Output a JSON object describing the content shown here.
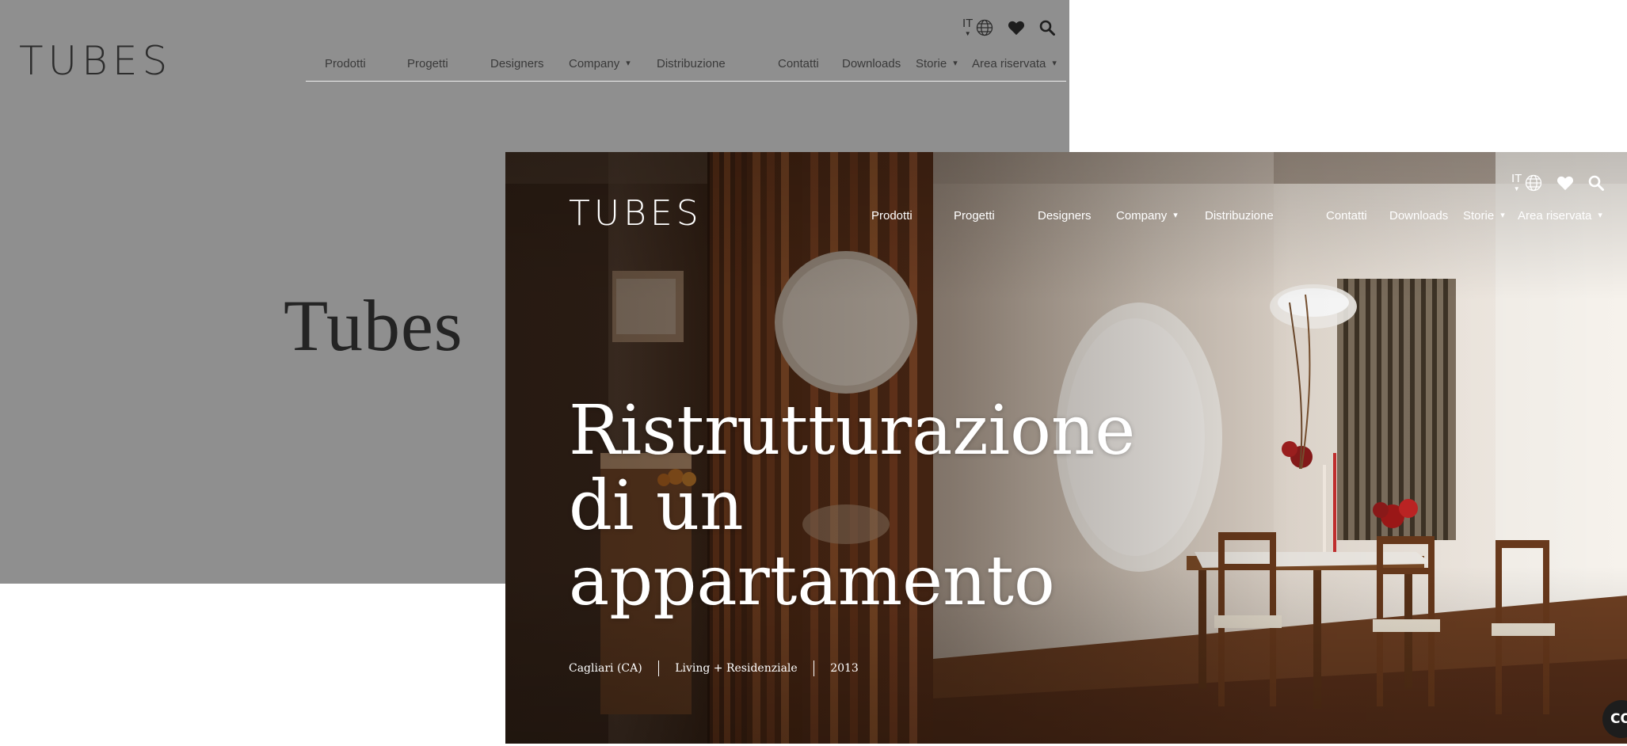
{
  "back": {
    "logo": "TUBES",
    "lang": "IT",
    "nav": {
      "prodotti": "Prodotti",
      "progetti": "Progetti",
      "designers": "Designers",
      "company": "Company",
      "distribuzione": "Distribuzione",
      "contatti": "Contatti",
      "downloads": "Downloads",
      "storie": "Storie",
      "area": "Area riservata"
    },
    "title": "Tubes"
  },
  "hero": {
    "logo": "TUBES",
    "lang": "IT",
    "nav": {
      "prodotti": "Prodotti",
      "progetti": "Progetti",
      "designers": "Designers",
      "company": "Company",
      "distribuzione": "Distribuzione",
      "contatti": "Contatti",
      "downloads": "Downloads",
      "storie": "Storie",
      "area": "Area riservata"
    },
    "title_line1": "Ristrutturazione",
    "title_line2": "di un",
    "title_line3": "appartamento",
    "location": "Cagliari (CA)",
    "category": "Living + Residenziale",
    "year": "2013",
    "chat_label": "CO"
  },
  "icons": {
    "globe": "globe-icon",
    "heart": "heart-icon",
    "search": "search-icon",
    "chat": "chat-icon"
  },
  "colors": {
    "overlay_grey": "#8f8f8f",
    "text_dark": "#2c2c2c",
    "hero_text": "#ffffff",
    "chat_bg": "#1d1d1d"
  }
}
